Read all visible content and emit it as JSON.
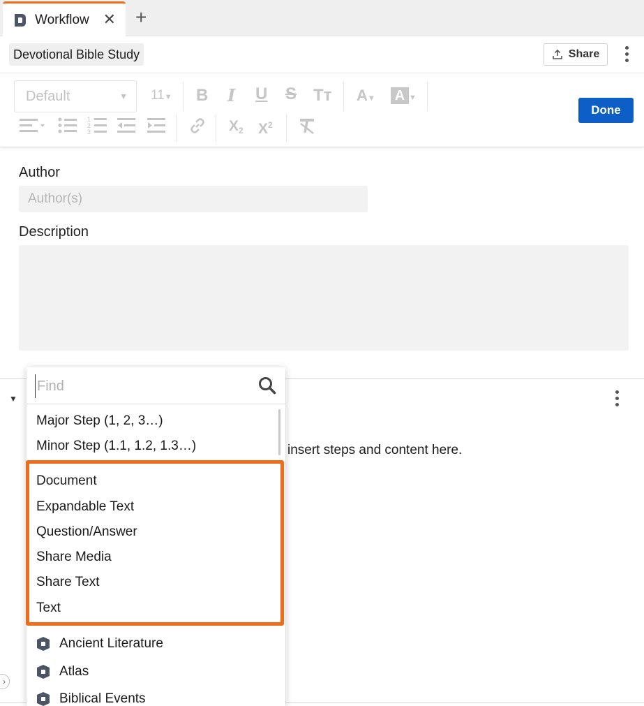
{
  "tabs": {
    "active_label": "Workflow",
    "close_glyph": "✕",
    "add_glyph": "+"
  },
  "header": {
    "document_title": "Devotional Bible Study",
    "share_label": "Share"
  },
  "toolbar": {
    "style_value": "Default",
    "size_value": "11",
    "done_label": "Done"
  },
  "form": {
    "author_label": "Author",
    "author_placeholder": "Author(s)",
    "description_label": "Description"
  },
  "section": {
    "hint_text": "insert steps and content here."
  },
  "popup": {
    "find_placeholder": "Find",
    "step_items": [
      "Major Step (1, 2, 3…)",
      "Minor Step (1.1, 1.2, 1.3…)"
    ],
    "content_items": [
      "Document",
      "Expandable Text",
      "Question/Answer",
      "Share Media",
      "Share Text",
      "Text"
    ],
    "resource_items": [
      "Ancient Literature",
      "Atlas",
      "Biblical Events"
    ]
  },
  "colors": {
    "accent_orange": "#ef6c1a",
    "primary_blue": "#0d5fc7",
    "icon_slate": "#4c5566"
  }
}
